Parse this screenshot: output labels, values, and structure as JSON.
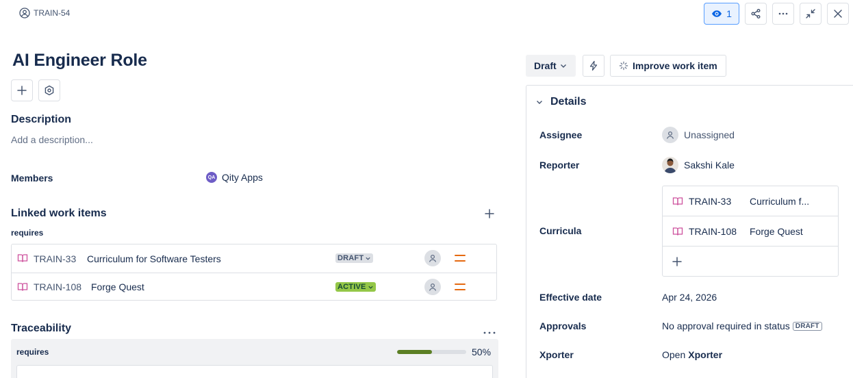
{
  "header": {
    "issue_key": "TRAIN-54",
    "watch_count": "1"
  },
  "title": "AI Engineer Role",
  "description": {
    "heading": "Description",
    "placeholder": "Add a description..."
  },
  "members": {
    "label": "Members",
    "badge": "QA",
    "value": "Qity Apps"
  },
  "linked": {
    "heading": "Linked work items",
    "relation": "requires",
    "items": [
      {
        "key": "TRAIN-33",
        "summary": "Curriculum for Software Testers",
        "status": "DRAFT"
      },
      {
        "key": "TRAIN-108",
        "summary": "Forge Quest",
        "status": "ACTIVE"
      }
    ]
  },
  "traceability": {
    "heading": "Traceability",
    "relation": "requires",
    "progress_text": "50%",
    "progress": 0.5
  },
  "actions": {
    "status_label": "Draft",
    "improve_label": "Improve work item"
  },
  "details": {
    "heading": "Details",
    "assignee_label": "Assignee",
    "assignee_value": "Unassigned",
    "reporter_label": "Reporter",
    "reporter_value": "Sakshi Kale",
    "curricula_label": "Curricula",
    "curricula": [
      {
        "key": "TRAIN-33",
        "summary": "Curriculum f..."
      },
      {
        "key": "TRAIN-108",
        "summary": "Forge Quest"
      }
    ],
    "effective_date_label": "Effective date",
    "effective_date_value": "Apr 24, 2026",
    "approvals_label": "Approvals",
    "approvals_value": "No approval required in status",
    "approvals_status": "DRAFT",
    "xporter_label": "Xporter",
    "xporter_prefix": "Open",
    "xporter_link": "Xporter"
  },
  "colors": {
    "accent": "#0c66e4",
    "book_icon": "#cd519d",
    "priority": "#e56910",
    "active_lozenge": "#94c748",
    "progress_fill": "#5b7f24"
  }
}
